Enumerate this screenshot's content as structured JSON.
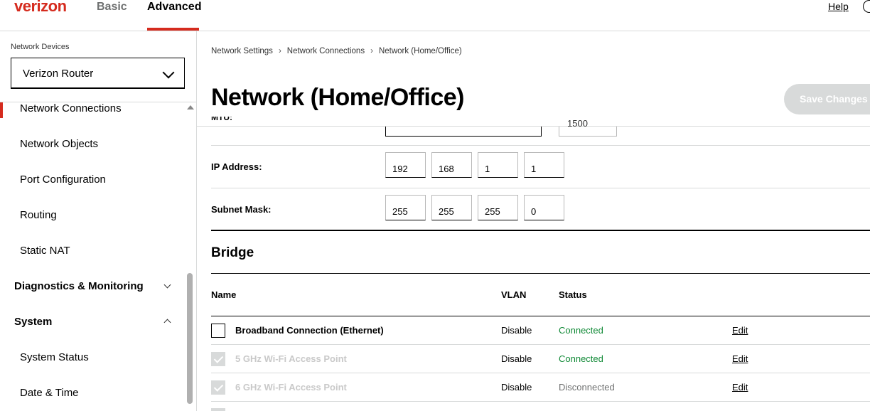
{
  "header": {
    "logo": "verizon",
    "tabs": [
      {
        "label": "Basic",
        "active": false
      },
      {
        "label": "Advanced",
        "active": true
      }
    ],
    "help_label": "Help",
    "user_icon": "user-circle-icon"
  },
  "sidebar": {
    "caption": "Network Devices",
    "device_select": {
      "value": "Verizon Router",
      "icon": "chevron-down-icon"
    },
    "items": [
      {
        "label": "Network Connections",
        "active": true
      },
      {
        "label": "Network Objects"
      },
      {
        "label": "Port Configuration"
      },
      {
        "label": "Routing"
      },
      {
        "label": "Static NAT"
      }
    ],
    "sections": [
      {
        "label": "Diagnostics & Monitoring",
        "expanded": false
      },
      {
        "label": "System",
        "expanded": true
      }
    ],
    "system_items": [
      {
        "label": "System Status"
      },
      {
        "label": "Date & Time"
      }
    ]
  },
  "breadcrumb": [
    "Network Settings",
    "Network Connections",
    "Network (Home/Office)"
  ],
  "page": {
    "title": "Network (Home/Office)",
    "save_label": "Save Changes"
  },
  "form": {
    "clipped_label": "MTU:",
    "clipped_value": "1500",
    "ip_address": {
      "label": "IP Address:",
      "octets": [
        "192",
        "168",
        "1",
        "1"
      ]
    },
    "subnet_mask": {
      "label": "Subnet Mask:",
      "octets": [
        "255",
        "255",
        "255",
        "0"
      ]
    }
  },
  "bridge": {
    "title": "Bridge",
    "headers": {
      "name": "Name",
      "vlan": "VLAN",
      "status": "Status"
    },
    "rows": [
      {
        "name": "Broadband Connection (Ethernet)",
        "vlan": "Disable",
        "status": "Connected",
        "action": "Edit",
        "checked": false,
        "disabled": false
      },
      {
        "name": "5 GHz Wi-Fi Access Point",
        "vlan": "Disable",
        "status": "Connected",
        "action": "Edit",
        "checked": true,
        "disabled": true
      },
      {
        "name": "6 GHz Wi-Fi Access Point",
        "vlan": "Disable",
        "status": "Disconnected",
        "action": "Edit",
        "checked": true,
        "disabled": true
      }
    ]
  },
  "colors": {
    "brand": "#d52b1e",
    "connected": "#118a37",
    "disabled": "#d8dada"
  }
}
